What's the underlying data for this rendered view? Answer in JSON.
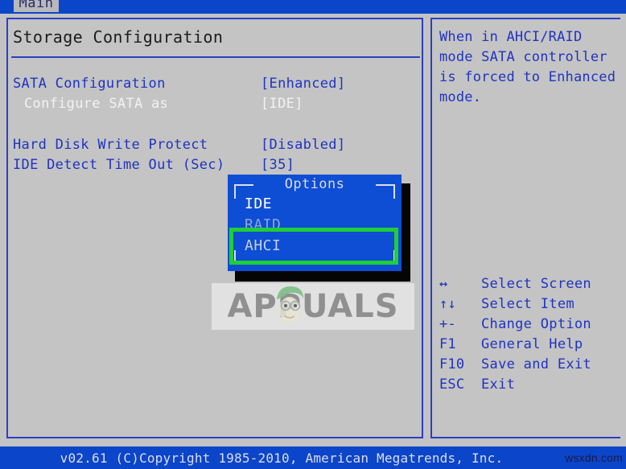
{
  "topbar": {
    "tabs": [
      {
        "label": "Main",
        "active": true
      }
    ]
  },
  "main_panel": {
    "title": "Storage Configuration",
    "rows": [
      {
        "label": "SATA Configuration",
        "value": "[Enhanced]",
        "selected": false
      },
      {
        "label": "Configure SATA as",
        "value": "[IDE]",
        "selected": true
      },
      {
        "label": "Hard Disk Write Protect",
        "value": "[Disabled]",
        "selected": false
      },
      {
        "label": "IDE Detect Time Out (Sec)",
        "value": "[35]",
        "selected": false
      }
    ]
  },
  "popup": {
    "title": "Options",
    "options": [
      {
        "label": "IDE",
        "state": "current"
      },
      {
        "label": "RAID",
        "state": "normal"
      },
      {
        "label": "AHCI",
        "state": "normal"
      }
    ]
  },
  "annotation": {
    "shape": "rectangle",
    "targets": "AHCI",
    "color": "#20cf35"
  },
  "help_panel": {
    "text": "When in AHCI/RAID mode SATA controller is forced to Enhanced mode.",
    "keys": [
      {
        "key": "↔",
        "action": "Select Screen",
        "icon": "left-right-arrow-icon"
      },
      {
        "key": "↑↓",
        "action": "Select Item",
        "icon": "up-down-arrow-icon"
      },
      {
        "key": "+-",
        "action": "Change Option",
        "icon": "plus-minus-icon"
      },
      {
        "key": "F1",
        "action": "General Help",
        "icon": "f1-key-icon"
      },
      {
        "key": "F10",
        "action": "Save and Exit",
        "icon": "f10-key-icon"
      },
      {
        "key": "ESC",
        "action": "Exit",
        "icon": "esc-key-icon"
      }
    ]
  },
  "footer": {
    "copyright": "v02.61 (C)Copyright 1985-2010, American Megatrends, Inc.",
    "watermark_url": "wsxdn.com"
  },
  "watermark": {
    "brand": "APPUALS"
  },
  "colors": {
    "bios_blue": "#0b45c9",
    "popup_blue": "#0d4ed4",
    "panel_gray": "#c4c4c4",
    "text_blue": "#1f34c0",
    "selected_white": "#f2f2f2",
    "annotation_green": "#20cf35"
  }
}
